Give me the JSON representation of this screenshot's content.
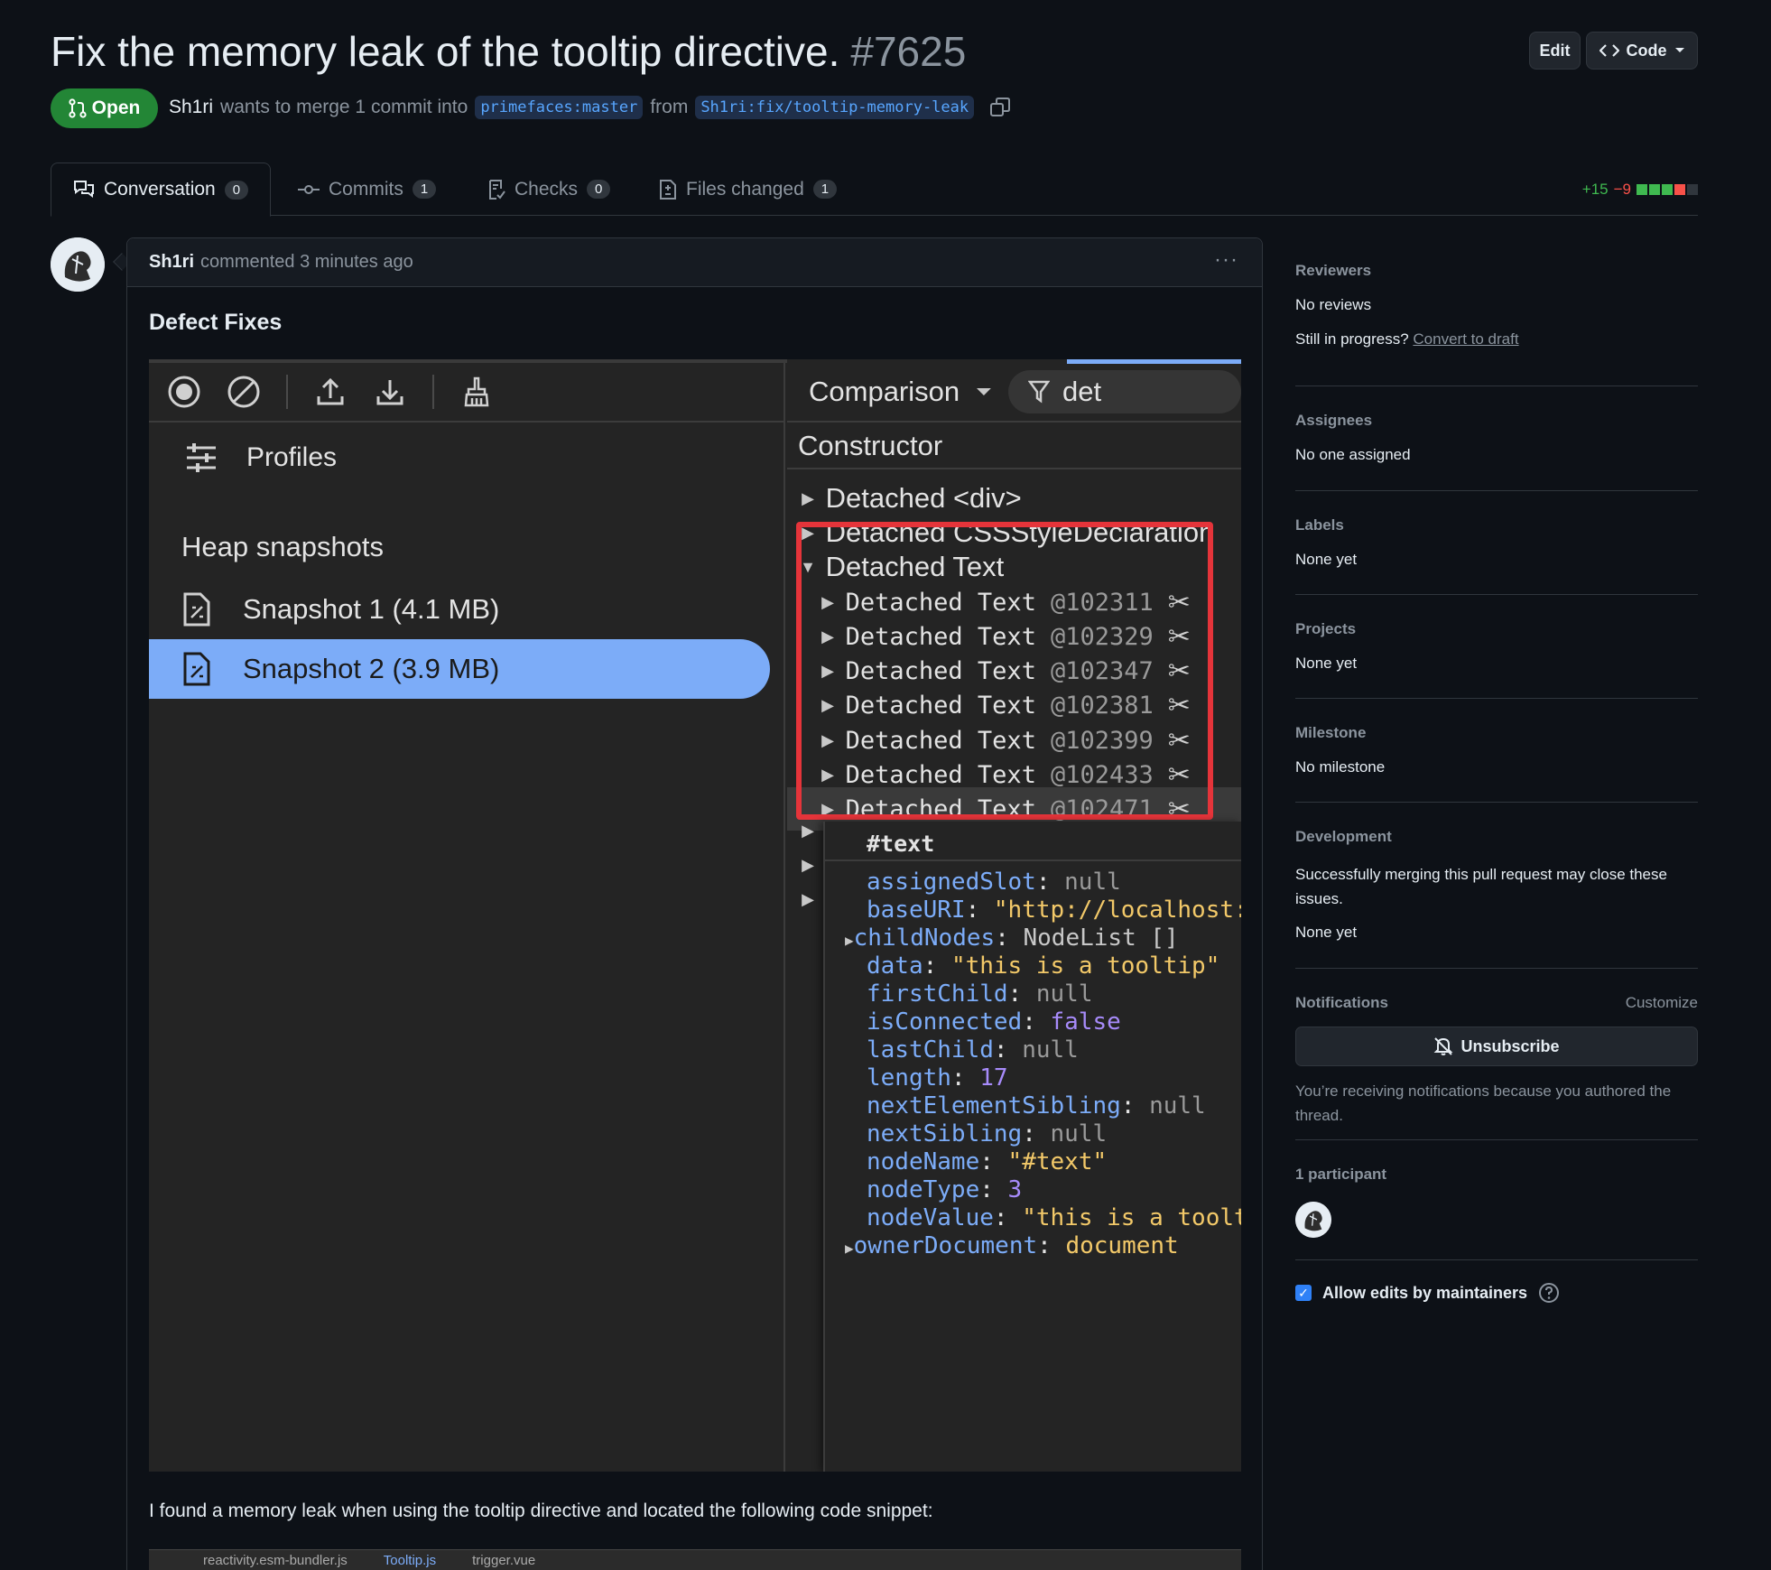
{
  "pr": {
    "title": "Fix the memory leak of the tooltip directive.",
    "number": "#7625",
    "state": "Open",
    "author": "Sh1ri",
    "merge_text": "wants to merge 1 commit into",
    "base_branch": "primefaces:master",
    "from_text": "from",
    "head_branch": "Sh1ri:fix/tooltip-memory-leak"
  },
  "header_buttons": {
    "edit": "Edit",
    "code": "Code"
  },
  "tabs": [
    {
      "label": "Conversation",
      "count": "0"
    },
    {
      "label": "Commits",
      "count": "1"
    },
    {
      "label": "Checks",
      "count": "0"
    },
    {
      "label": "Files changed",
      "count": "1"
    }
  ],
  "diffstat": {
    "additions": "+15",
    "deletions": "−9"
  },
  "colors": {
    "open_badge": "#238636",
    "link": "#58a6ff",
    "add": "#3fb950",
    "del": "#f85149",
    "highlight": "#e5343a"
  },
  "comment": {
    "author": "Sh1ri",
    "meta": "commented 3 minutes ago",
    "menu": "···",
    "heading": "Defect Fixes",
    "body_text": "I found a memory leak when using the tooltip directive and located the following code snippet:",
    "code_tabs": [
      "reactivity.esm-bundler.js",
      "Tooltip.js",
      "trigger.vue"
    ]
  },
  "devtools": {
    "profiles_label": "Profiles",
    "heap_title": "Heap snapshots",
    "snapshots": [
      "Snapshot 1 (4.1 MB)",
      "Snapshot 2 (3.9 MB)"
    ],
    "view_mode": "Comparison",
    "filter": "det",
    "column_header": "Constructor",
    "groups": [
      "Detached <div>",
      "Detached CSSStyleDeclaration",
      "Detached Text"
    ],
    "entries": [
      {
        "name": "Detached Text",
        "id": "@102311"
      },
      {
        "name": "Detached Text",
        "id": "@102329"
      },
      {
        "name": "Detached Text",
        "id": "@102347"
      },
      {
        "name": "Detached Text",
        "id": "@102381"
      },
      {
        "name": "Detached Text",
        "id": "@102399"
      },
      {
        "name": "Detached Text",
        "id": "@102433"
      },
      {
        "name": "Detached Text",
        "id": "@102471"
      }
    ],
    "object_title": "#text",
    "properties": [
      {
        "key": "assignedSlot",
        "value": "null"
      },
      {
        "key": "baseURI",
        "value": "\"http://localhost:"
      },
      {
        "key": "childNodes",
        "value": "NodeList  []"
      },
      {
        "key": "data",
        "value": "\"this is a tooltip\""
      },
      {
        "key": "firstChild",
        "value": "null"
      },
      {
        "key": "isConnected",
        "value": "false"
      },
      {
        "key": "lastChild",
        "value": "null"
      },
      {
        "key": "length",
        "value": "17"
      },
      {
        "key": "nextElementSibling",
        "value": "null"
      },
      {
        "key": "nextSibling",
        "value": "null"
      },
      {
        "key": "nodeName",
        "value": "\"#text\""
      },
      {
        "key": "nodeType",
        "value": "3"
      },
      {
        "key": "nodeValue",
        "value": "\"this is a toolt"
      },
      {
        "key": "ownerDocument",
        "value": "document"
      }
    ]
  },
  "sidebar": {
    "reviewers": {
      "heading": "Reviewers",
      "value": "No reviews",
      "progress_text": "Still in progress?",
      "progress_link": "Convert to draft"
    },
    "assignees": {
      "heading": "Assignees",
      "value": "No one assigned"
    },
    "labels": {
      "heading": "Labels",
      "value": "None yet"
    },
    "projects": {
      "heading": "Projects",
      "value": "None yet"
    },
    "milestone": {
      "heading": "Milestone",
      "value": "No milestone"
    },
    "development": {
      "heading": "Development",
      "description": "Successfully merging this pull request may close these issues.",
      "value": "None yet"
    },
    "notifications": {
      "heading": "Notifications",
      "customize": "Customize",
      "button": "Unsubscribe",
      "reason": "You’re receiving notifications because you authored the thread."
    },
    "participants": {
      "heading": "1 participant"
    },
    "allow_edits": "Allow edits by maintainers"
  }
}
